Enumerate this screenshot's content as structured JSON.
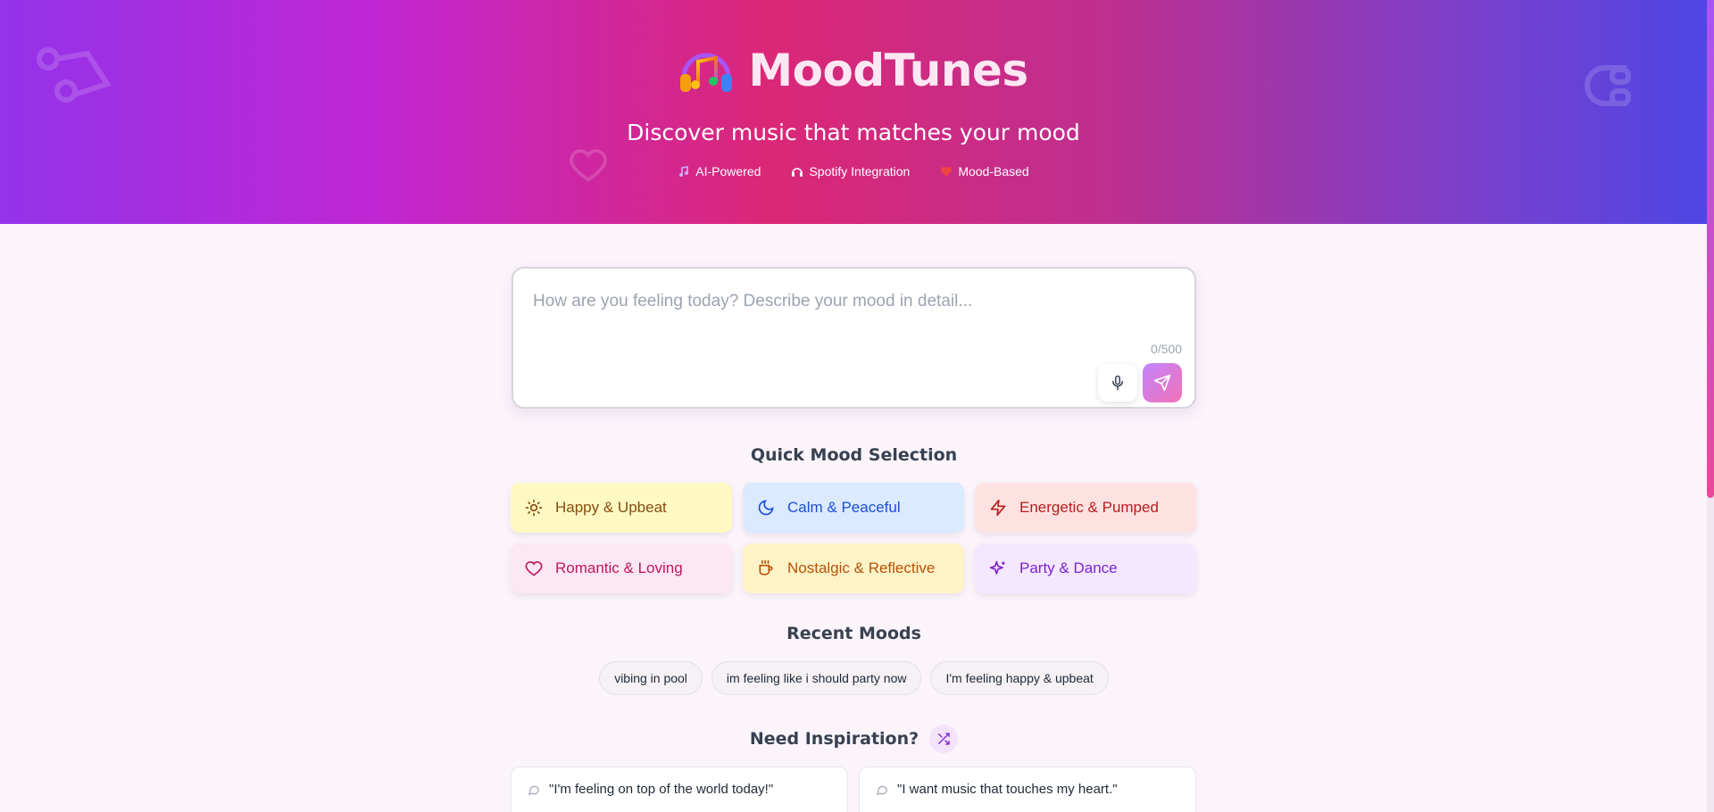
{
  "header": {
    "title": "MoodTunes",
    "subtitle": "Discover music that matches your mood",
    "features": [
      {
        "label": "AI-Powered",
        "icon": "music-note-icon"
      },
      {
        "label": "Spotify Integration",
        "icon": "headphones-icon"
      },
      {
        "label": "Mood-Based",
        "icon": "heart-icon"
      }
    ]
  },
  "mood_input": {
    "placeholder": "How are you feeling today? Describe your mood in detail...",
    "value": "",
    "char_count": "0/500"
  },
  "quick_moods": {
    "title": "Quick Mood Selection",
    "items": [
      {
        "label": "Happy & Upbeat",
        "icon": "sun-icon",
        "bg": "#fef9c3",
        "fg": "#854d0e"
      },
      {
        "label": "Calm & Peaceful",
        "icon": "moon-icon",
        "bg": "#dbeafe",
        "fg": "#1d4ed8"
      },
      {
        "label": "Energetic & Pumped",
        "icon": "lightning-icon",
        "bg": "#fee2e2",
        "fg": "#b91c1c"
      },
      {
        "label": "Romantic & Loving",
        "icon": "heart-icon",
        "bg": "#fce7f3",
        "fg": "#be185d"
      },
      {
        "label": "Nostalgic & Reflective",
        "icon": "coffee-cup-icon",
        "bg": "#fef3c7",
        "fg": "#b45309"
      },
      {
        "label": "Party & Dance",
        "icon": "sparkles-icon",
        "bg": "#f3e8ff",
        "fg": "#7e22ce"
      }
    ]
  },
  "recent_moods": {
    "title": "Recent Moods",
    "items": [
      "vibing in pool",
      "im feeling like i should party now",
      "I'm feeling happy & upbeat"
    ]
  },
  "inspiration": {
    "title": "Need Inspiration?",
    "items": [
      "\"I'm feeling on top of the world today!\"",
      "\"I want music that touches my heart.\""
    ]
  }
}
